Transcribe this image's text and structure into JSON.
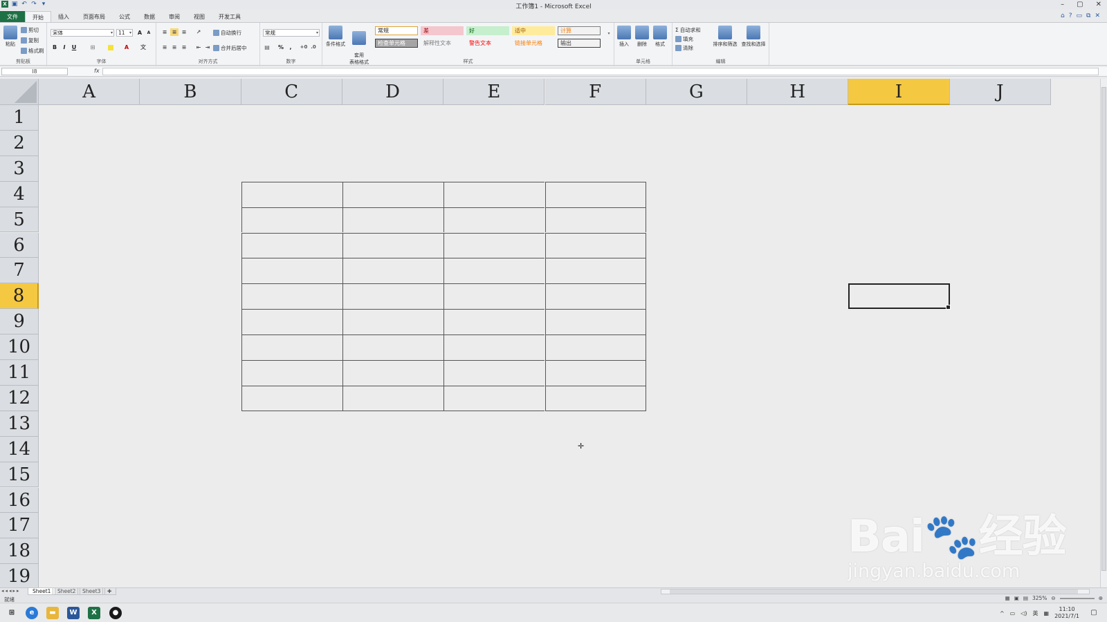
{
  "window": {
    "title": "工作簿1 - Microsoft Excel",
    "controls": [
      "–",
      "▢",
      "✕"
    ]
  },
  "ribbon": {
    "tabs": [
      "文件",
      "开始",
      "插入",
      "页面布局",
      "公式",
      "数据",
      "审阅",
      "视图",
      "开发工具"
    ],
    "active_tab": "开始",
    "clipboard": {
      "paste": "粘贴",
      "cut": "剪切",
      "copy": "复制",
      "format_painter": "格式刷",
      "label": "剪贴板"
    },
    "font": {
      "name": "宋体",
      "size": "11",
      "bold": "B",
      "italic": "I",
      "underline": "U",
      "label": "字体"
    },
    "alignment": {
      "wrap": "自动换行",
      "merge": "合并后居中",
      "label": "对齐方式"
    },
    "number": {
      "format": "常规",
      "percent": "%",
      "comma": ",",
      "label": "数字"
    },
    "styles": {
      "conditional": "条件格式",
      "table_format": "套用\n表格格式",
      "cells": [
        {
          "text": "常规",
          "bg": "#ffffff",
          "color": "#222222",
          "border": "#e2a33a"
        },
        {
          "text": "差",
          "bg": "#f4c7ce",
          "color": "#9c0006",
          "border": "#f4c7ce"
        },
        {
          "text": "好",
          "bg": "#c6efce",
          "color": "#006100",
          "border": "#c6efce"
        },
        {
          "text": "适中",
          "bg": "#ffeb9c",
          "color": "#9c5700",
          "border": "#ffeb9c"
        },
        {
          "text": "计算",
          "bg": "#f2f2f2",
          "color": "#fa7d00",
          "border": "#7f7f7f"
        },
        {
          "text": "检查单元格",
          "bg": "#a5a5a5",
          "color": "#ffffff",
          "border": "#3f3f3f"
        },
        {
          "text": "解释性文本",
          "bg": "#f3f4f6",
          "color": "#7f7f7f",
          "border": "#f3f4f6"
        },
        {
          "text": "警告文本",
          "bg": "#f3f4f6",
          "color": "#ff0000",
          "border": "#f3f4f6"
        },
        {
          "text": "链接单元格",
          "bg": "#f3f4f6",
          "color": "#fa7d00",
          "border": "#f3f4f6"
        },
        {
          "text": "输出",
          "bg": "#f2f2f2",
          "color": "#3f3f3f",
          "border": "#3f3f3f"
        }
      ],
      "label": "样式"
    },
    "cells_group": {
      "insert": "插入",
      "delete": "删除",
      "format": "格式",
      "label": "单元格"
    },
    "editing": {
      "autosum": "自动求和",
      "fill": "填充",
      "clear": "清除",
      "sort": "排序和筛选",
      "find": "查找和选择",
      "label": "编辑"
    }
  },
  "formula_bar": {
    "name_box": "I8",
    "fx": "fx",
    "value": ""
  },
  "grid": {
    "columns": [
      "A",
      "B",
      "C",
      "D",
      "E",
      "F",
      "G",
      "H",
      "I",
      "J"
    ],
    "rows": [
      "1",
      "2",
      "3",
      "4",
      "5",
      "6",
      "7",
      "8",
      "9",
      "10",
      "11",
      "12",
      "13",
      "14",
      "15",
      "16",
      "17",
      "18",
      "19"
    ],
    "selected_column": "I",
    "selected_row": "8",
    "active_cell": "I8",
    "bordered_range": "C4:F12"
  },
  "sheets": {
    "tabs": [
      "Sheet1",
      "Sheet2",
      "Sheet3"
    ],
    "active": "Sheet1"
  },
  "status": {
    "ready": "就绪",
    "zoom": "325%"
  },
  "taskbar": {
    "ime": "英",
    "time": "11:10",
    "date": "2021/7/1"
  },
  "watermark": {
    "brand": "Bai",
    "brand2": "经验",
    "url": "jingyan.baidu.com"
  },
  "colors": {
    "excel_green": "#1e7145",
    "header_selected": "#f5c842",
    "grid_bg": "#ececec"
  }
}
